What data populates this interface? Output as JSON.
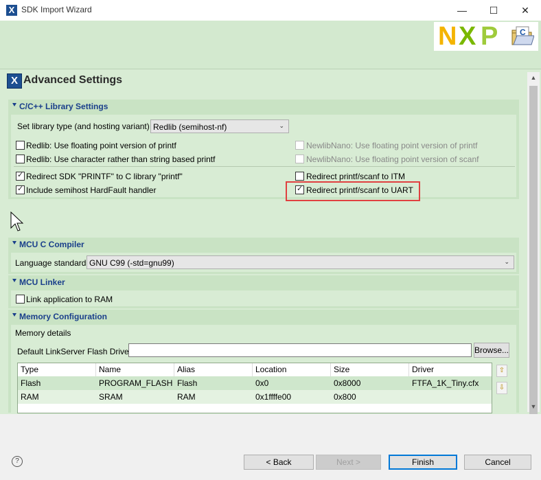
{
  "window": {
    "title": "SDK Import Wizard",
    "minimize": "—",
    "maximize": "☐",
    "close": "✕"
  },
  "page": {
    "title": "Advanced Settings"
  },
  "sections": {
    "library": {
      "title": "C/C++ Library Settings",
      "library_type_label": "Set library type (and hosting variant)",
      "library_type_value": "Redlib (semihost-nf)",
      "options": {
        "redlib_float_printf": "Redlib: Use floating point version of printf",
        "redlib_char_printf": "Redlib: Use character rather than string based printf",
        "newlib_float_printf": "NewlibNano: Use floating point version of printf",
        "newlib_float_scanf": "NewlibNano: Use floating point version of scanf",
        "redirect_sdk_printf": "Redirect SDK \"PRINTF\" to C library \"printf\"",
        "include_hardfault": "Include semihost HardFault handler",
        "redirect_itm": "Redirect printf/scanf to ITM",
        "redirect_uart": "Redirect printf/scanf to UART"
      }
    },
    "compiler": {
      "title": "MCU C Compiler",
      "language_label": "Language standard",
      "language_value": "GNU C99 (-std=gnu99)"
    },
    "linker": {
      "title": "MCU Linker",
      "link_ram_label": "Link application to RAM"
    },
    "memory": {
      "title": "Memory Configuration",
      "details_label": "Memory details",
      "flash_driver_label": "Default LinkServer Flash Driver",
      "flash_driver_value": "",
      "browse_label": "Browse...",
      "columns": [
        "Type",
        "Name",
        "Alias",
        "Location",
        "Size",
        "Driver"
      ],
      "rows": [
        [
          "Flash",
          "PROGRAM_FLASH",
          "Flash",
          "0x0",
          "0x8000",
          "FTFA_1K_Tiny.cfx"
        ],
        [
          "RAM",
          "SRAM",
          "RAM",
          "0x1ffffe00",
          "0x800",
          ""
        ]
      ]
    }
  },
  "buttons": {
    "back": "< Back",
    "next": "Next >",
    "finish": "Finish",
    "cancel": "Cancel",
    "help": "?"
  },
  "colors": {
    "header_bg": "#d3e9cf",
    "section_title": "#1a3f8b",
    "highlight_box": "#e04040",
    "primary_border": "#0078d7"
  }
}
